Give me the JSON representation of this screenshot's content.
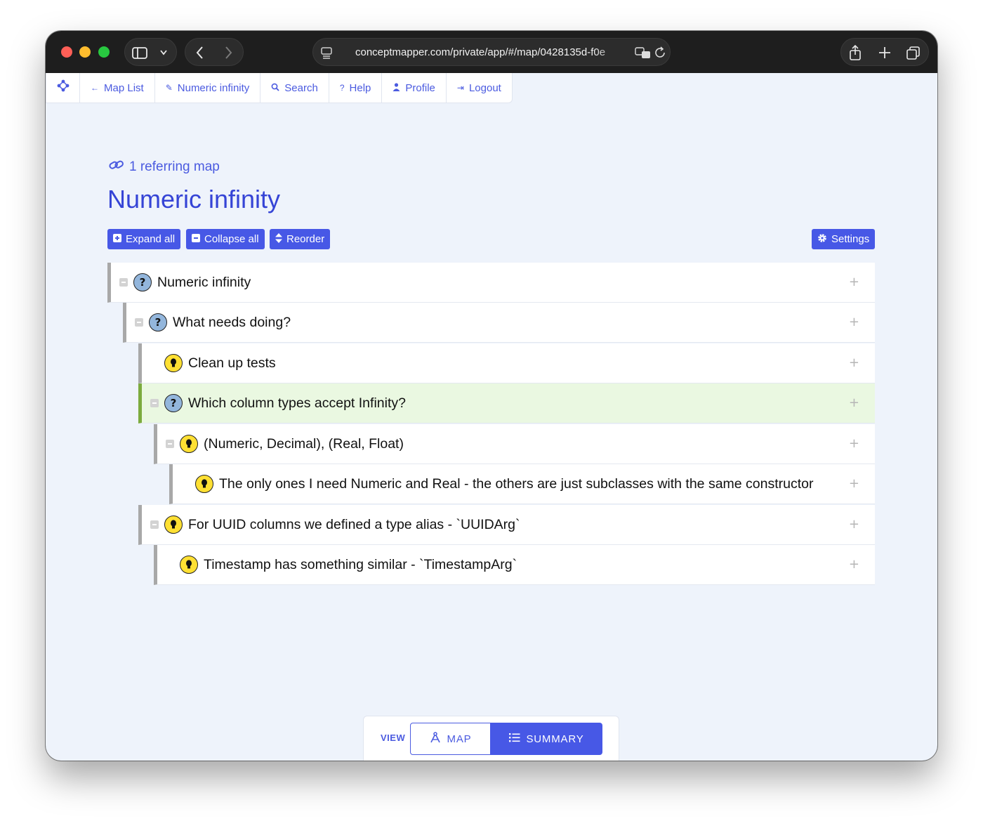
{
  "browser": {
    "url": "conceptmapper.com/private/app/#/map/0428135d-f0e",
    "sidebar_icon": "sidebar-icon",
    "back_icon": "back-icon",
    "forward_icon": "forward-icon",
    "share_icon": "share-icon",
    "new_tab_icon": "plus-icon",
    "tabs_icon": "tabs-icon"
  },
  "nav": {
    "items": [
      {
        "label": "Map List",
        "icon": "←"
      },
      {
        "label": "Numeric infinity",
        "icon": "✎"
      },
      {
        "label": "Search",
        "icon": "🔍"
      },
      {
        "label": "Help",
        "icon": "?"
      },
      {
        "label": "Profile",
        "icon": "👤"
      },
      {
        "label": "Logout",
        "icon": "⇥"
      }
    ]
  },
  "page": {
    "referring": "1 referring map",
    "title": "Numeric infinity"
  },
  "toolbar": {
    "expand_all": "Expand all",
    "collapse_all": "Collapse all",
    "reorder": "Reorder",
    "settings": "Settings"
  },
  "tree": {
    "rows": [
      {
        "text": "Numeric infinity",
        "type": "question",
        "depth": 0,
        "collapsible": true,
        "highlight": false
      },
      {
        "text": "What needs doing?",
        "type": "question",
        "depth": 1,
        "collapsible": true,
        "highlight": false
      },
      {
        "text": "Clean up tests",
        "type": "idea",
        "depth": 2,
        "collapsible": false,
        "highlight": false
      },
      {
        "text": "Which column types accept Infinity?",
        "type": "question",
        "depth": 2,
        "collapsible": true,
        "highlight": true
      },
      {
        "text": "(Numeric, Decimal), (Real, Float)",
        "type": "idea",
        "depth": 3,
        "collapsible": true,
        "highlight": false
      },
      {
        "text": "The only ones I need Numeric and Real - the others are just subclasses with the same constructor",
        "type": "idea",
        "depth": 4,
        "collapsible": false,
        "highlight": false
      },
      {
        "text": "For UUID columns we defined a type alias - `UUIDArg`",
        "type": "idea",
        "depth": 2,
        "collapsible": true,
        "highlight": false
      },
      {
        "text": "Timestamp has something similar - `TimestampArg`",
        "type": "idea",
        "depth": 3,
        "collapsible": false,
        "highlight": false
      }
    ],
    "add_symbol": "+"
  },
  "view": {
    "label": "VIEW",
    "map": "MAP",
    "summary": "SUMMARY",
    "active": "summary"
  },
  "colors": {
    "accent": "#4758e6",
    "title": "#3544d6",
    "highlight_row": "#eaf8e1",
    "highlight_border": "#7cab3e",
    "question_icon": "#93b6dc",
    "idea_icon": "#ffe033"
  }
}
